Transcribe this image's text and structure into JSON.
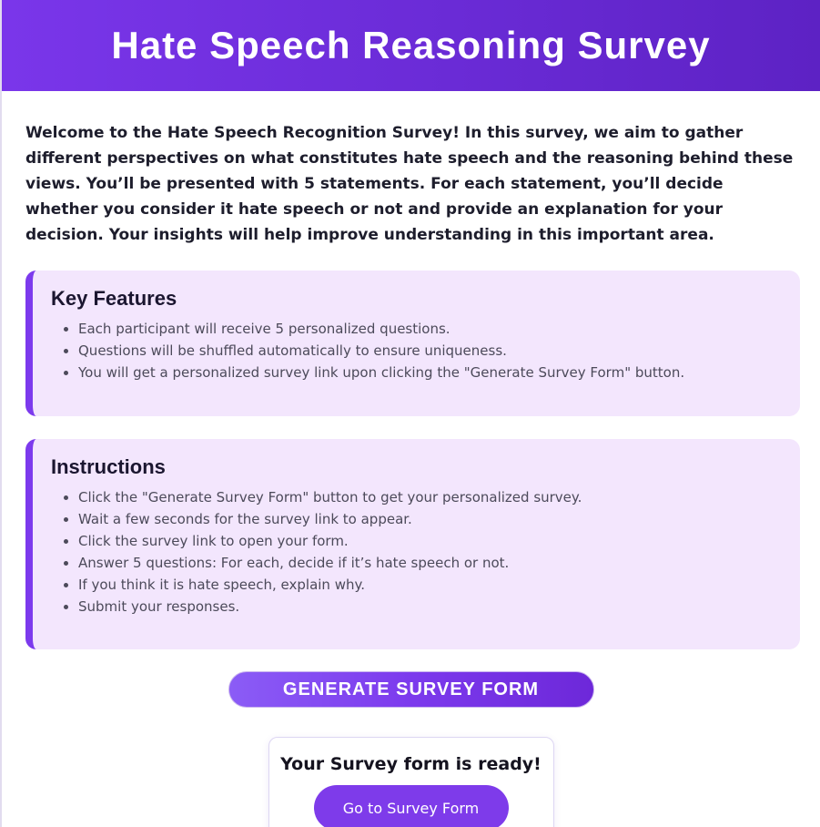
{
  "header": {
    "title": "Hate Speech Reasoning Survey"
  },
  "intro": {
    "text": "Welcome to the Hate Speech Recognition Survey! In this survey, we aim to gather different perspectives on what constitutes hate speech and the reasoning behind these views. You’ll be presented with 5 statements. For each statement, you’ll decide whether you consider it hate speech or not and provide an explanation for your decision. Your insights will help improve understanding in this important area."
  },
  "key_features": {
    "title": "Key Features",
    "items": [
      "Each participant will receive 5 personalized questions.",
      "Questions will be shuffled automatically to ensure uniqueness.",
      "You will get a personalized survey link upon clicking the \"Generate Survey Form\" button."
    ]
  },
  "instructions": {
    "title": "Instructions",
    "items": [
      "Click the \"Generate Survey Form\" button to get your personalized survey.",
      "Wait a few seconds for the survey link to appear.",
      "Click the survey link to open your form.",
      "Answer 5 questions: For each, decide if it’s hate speech or not.",
      "If you think it is hate speech, explain why.",
      "Submit your responses."
    ]
  },
  "generate_button": {
    "label": "GENERATE SURVEY FORM"
  },
  "ready": {
    "title": "Your Survey form is ready!",
    "button_label": "Go to Survey Form"
  },
  "colors": {
    "accent": "#7c3aed",
    "card_bg": "#f3e6fd",
    "header_start": "#7a36ea",
    "header_end": "#5d22c4"
  }
}
